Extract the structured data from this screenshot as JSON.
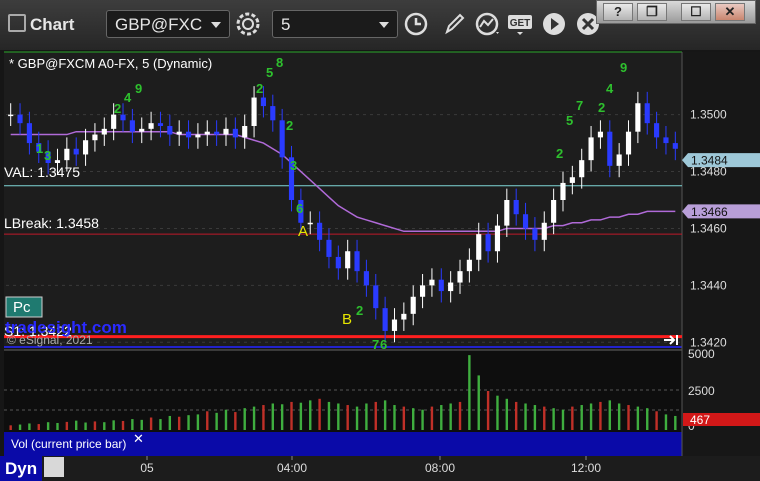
{
  "toolbar": {
    "title": "Chart",
    "symbol": "GBP@FXC",
    "interval": "5",
    "window_buttons": [
      "?",
      "❐",
      "☐",
      "✕"
    ],
    "icons": [
      "gear-icon",
      "clock-icon",
      "pencil-icon",
      "study-icon",
      "get-icon",
      "play-icon",
      "x-icon"
    ]
  },
  "chart": {
    "header": "* GBP@FXCM A0-FX, 5 (Dynamic)",
    "copyright": "© eSignal, 2021",
    "watermark": "tradesight.com",
    "pc_badge": "Pc",
    "levels": [
      {
        "label": "VAL: 1.3475",
        "value": 1.3475,
        "color": "#7fd7d7"
      },
      {
        "label": "LBreak: 1.3458",
        "value": 1.3458,
        "color": "#c0182a"
      },
      {
        "label": "S1: 1.3422",
        "value": 1.3422,
        "color": "#ff1f1f"
      }
    ],
    "price_tags": [
      {
        "text": "1.3484",
        "value": 1.3484,
        "bg": "#9ec8d8"
      },
      {
        "text": "1.3466",
        "value": 1.3466,
        "bg": "#b89ed8"
      }
    ],
    "annotations": [
      "A",
      "B"
    ],
    "price_axis_ticks": [
      "1.3500",
      "1.3480",
      "1.3460",
      "1.3440",
      "1.3420"
    ],
    "time_axis_ticks": [
      "05",
      "04:00",
      "08:00",
      "12:00"
    ]
  },
  "volume": {
    "label": "Vol (current price bar)",
    "close_glyph": "✕",
    "current": "467",
    "axis_ticks": [
      "5000",
      "2500",
      "0"
    ]
  },
  "footer": {
    "label": "Dyn"
  },
  "chart_data": {
    "type": "candlestick",
    "title": "* GBP@FXCM A0-FX, 5 (Dynamic)",
    "ylim": [
      1.3418,
      1.3522
    ],
    "x_ticks": [
      "05",
      "04:00",
      "08:00",
      "12:00"
    ],
    "price": [
      1.35,
      1.3497,
      1.349,
      1.3487,
      1.3483,
      1.3484,
      1.3488,
      1.3486,
      1.3491,
      1.3493,
      1.3495,
      1.35,
      1.3498,
      1.3494,
      1.3495,
      1.3497,
      1.3496,
      1.3493,
      1.3494,
      1.3492,
      1.3493,
      1.3494,
      1.3493,
      1.3495,
      1.3492,
      1.3496,
      1.3506,
      1.3503,
      1.3498,
      1.3485,
      1.347,
      1.3462,
      1.3462,
      1.3456,
      1.345,
      1.3446,
      1.3452,
      1.3445,
      1.344,
      1.3432,
      1.3424,
      1.3428,
      1.343,
      1.3436,
      1.344,
      1.3442,
      1.3438,
      1.3441,
      1.3445,
      1.3449,
      1.3458,
      1.3452,
      1.3461,
      1.347,
      1.3465,
      1.346,
      1.3456,
      1.3462,
      1.347,
      1.3476,
      1.3478,
      1.3484,
      1.3492,
      1.3494,
      1.3482,
      1.3486,
      1.3494,
      1.3504,
      1.3497,
      1.3492,
      1.349,
      1.3488
    ],
    "series": [
      {
        "name": "",
        "role": "moving-average",
        "color": "#b06ad8",
        "values": [
          1.3493,
          1.3493,
          1.3493,
          1.3493,
          1.3493,
          1.3493,
          1.3493,
          1.3494,
          1.3494,
          1.3494,
          1.3494,
          1.3494,
          1.3494,
          1.3494,
          1.3494,
          1.3494,
          1.3494,
          1.3494,
          1.3493,
          1.3493,
          1.3493,
          1.3493,
          1.3493,
          1.3493,
          1.3493,
          1.3492,
          1.3491,
          1.349,
          1.3488,
          1.3486,
          1.3483,
          1.348,
          1.3477,
          1.3474,
          1.3471,
          1.3468,
          1.3466,
          1.3464,
          1.3463,
          1.3462,
          1.3461,
          1.346,
          1.3459,
          1.3459,
          1.3459,
          1.3459,
          1.3459,
          1.3459,
          1.3459,
          1.3459,
          1.3459,
          1.3459,
          1.3459,
          1.346,
          1.346,
          1.346,
          1.346,
          1.346,
          1.3461,
          1.3461,
          1.3462,
          1.3462,
          1.3463,
          1.3463,
          1.3464,
          1.3464,
          1.3465,
          1.3465,
          1.3466,
          1.3466,
          1.3466,
          1.3466
        ]
      }
    ],
    "volume": {
      "ylim": [
        0,
        5000
      ],
      "values": [
        300,
        350,
        420,
        380,
        500,
        450,
        520,
        600,
        480,
        550,
        500,
        620,
        580,
        700,
        650,
        800,
        700,
        900,
        850,
        950,
        1000,
        1200,
        1100,
        1300,
        1150,
        1400,
        1500,
        1600,
        1700,
        1650,
        1800,
        1750,
        1900,
        2000,
        1800,
        1700,
        1600,
        1500,
        1700,
        1800,
        1900,
        1600,
        1500,
        1400,
        1300,
        1500,
        1600,
        1700,
        1800,
        4800,
        3500,
        2500,
        2200,
        2000,
        1800,
        1700,
        1600,
        1500,
        1400,
        1300,
        1500,
        1600,
        1700,
        1800,
        1900,
        1700,
        1600,
        1500,
        1400,
        1200,
        1000,
        900
      ]
    }
  }
}
